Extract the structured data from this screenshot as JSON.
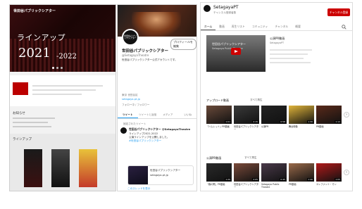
{
  "website": {
    "logo": "世田谷パブリックシアター",
    "hero_title": "ラインアップ",
    "hero_year": "2021",
    "hero_year_end": "-2022",
    "news_heading": "お知らせ",
    "lineup_heading": "ラインアップ"
  },
  "twitter": {
    "avatar_text": "世田谷パブリックシアター",
    "edit_button": "プロフィールを編集",
    "display_name": "世田谷パブリックシアター",
    "handle": "@SetagayaTheatre",
    "bio": "世田谷パブリックシアター公式アカウントです。",
    "location": "東京 世田谷区",
    "link": "setagaya-pt.jp",
    "follow_stats": "フォロー中 / フォロワー",
    "tabs": [
      "ツイート",
      "ツイートと返信",
      "メディア",
      "いいね"
    ],
    "pinned_label": "固定されたツイート",
    "tweet_author": "世田谷パブリックシアター @SetagayaTheatre",
    "tweet_line1": "ラインアップ2021-2022",
    "tweet_line2": "公演ラインアップを公開しました。",
    "tweet_link": "#世田谷パブリックシアター",
    "card_title": "世田谷パブリックシアター",
    "card_sub": "setagaya-pt.jp",
    "show_thread": "このスレッドを表示"
  },
  "youtube": {
    "channel_name": "SetagayaPT",
    "subscribers": "チャンネル登録者数",
    "subscribe_button": "チャンネル登録",
    "tabs": [
      "ホーム",
      "動画",
      "再生リスト",
      "コミュニティ",
      "チャンネル",
      "概要"
    ],
    "featured_overlay_1": "世田谷パブリックシアター",
    "featured_overlay_2": "Setagaya Public Theatre",
    "featured_title": "公演PR動画",
    "featured_meta": "SetagayaPT",
    "section1_title": "アップロード動画",
    "section1_play_all": "すべて再生",
    "section2_title": "公演PR動画",
    "section2_play_all": "すべて再生",
    "row1": [
      {
        "caption": "「ハムレット」PR動画",
        "dur": "1:01",
        "color": "#6a4a3a"
      },
      {
        "caption": "世田谷パブリックシアター",
        "dur": "2:15",
        "color": "#3a3a3a"
      },
      {
        "caption": "公演PR",
        "dur": "0:58",
        "color": "#222222"
      },
      {
        "caption": "舞台映像",
        "dur": "1:30",
        "color": "#e0b43a"
      },
      {
        "caption": "PR動画",
        "dur": "1:12",
        "color": "#5a2a1a"
      }
    ],
    "row2": [
      {
        "caption": "「森の歌」PR動画",
        "dur": "1:20",
        "color": "#2a2a2a"
      },
      {
        "caption": "世田谷パブリックシアター",
        "dur": "2:05",
        "color": "#7a4a3a"
      },
      {
        "caption": "Setagaya Public Theatre",
        "dur": "0:45",
        "color": "#4a3a4a"
      },
      {
        "caption": "PR動画",
        "dur": "1:40",
        "color": "#9a6a4a"
      },
      {
        "caption": "エレファント・マン",
        "dur": "1:05",
        "color": "#b01a1a"
      }
    ],
    "arrow_glyph": "›"
  }
}
